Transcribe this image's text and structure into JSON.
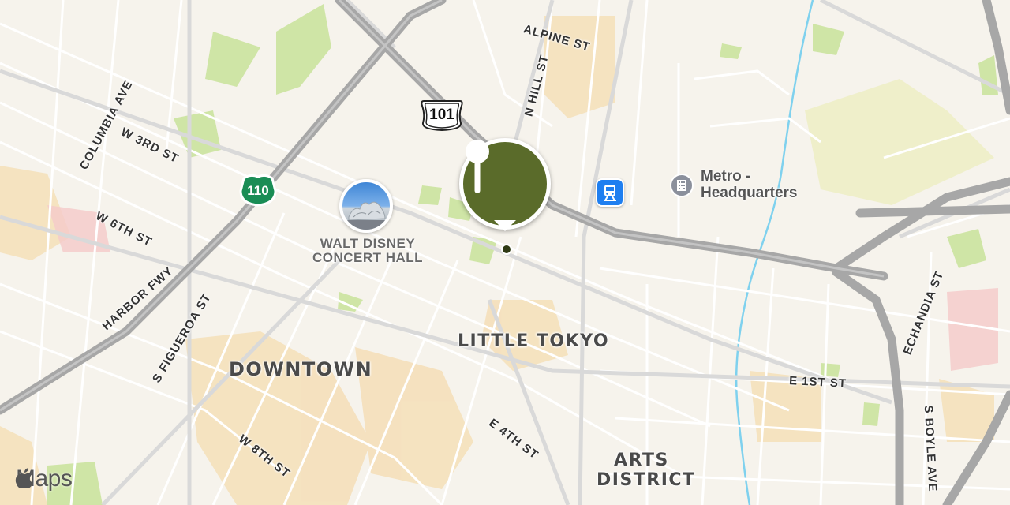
{
  "map": {
    "streets": {
      "alpine": "ALPINE ST",
      "n_hill": "N HILL ST",
      "columbia": "COLUMBIA AVE",
      "w3rd": "W 3RD ST",
      "w6th": "W 6TH ST",
      "harbor": "HARBOR FWY",
      "s_figueroa": "S FIGUEROA ST",
      "w8th": "W 8TH ST",
      "e4th": "E 4TH ST",
      "e1st": "E 1ST ST",
      "echandia": "ECHANDIA ST",
      "s_boyle": "S BOYLE AVE"
    },
    "districts": {
      "downtown": "DOWNTOWN",
      "little_tokyo": "LITTLE TOKYO",
      "arts_line1": "ARTS",
      "arts_line2": "DISTRICT"
    },
    "shields": {
      "us101": "101",
      "ca110": "110"
    },
    "pois": {
      "concert_line1": "WALT DISNEY",
      "concert_line2": "CONCERT HALL",
      "metro_line1": "Metro -",
      "metro_line2": "Headquarters"
    },
    "pin_icon": "map-pin-marker-icon",
    "colors": {
      "pin": "#5a6b2a",
      "park": "#cfe5a6",
      "freeway": "#a7a7a7",
      "transit": "#1f7ff0",
      "river": "#7fd1ee"
    }
  },
  "branding": {
    "maps_label": "Maps"
  }
}
